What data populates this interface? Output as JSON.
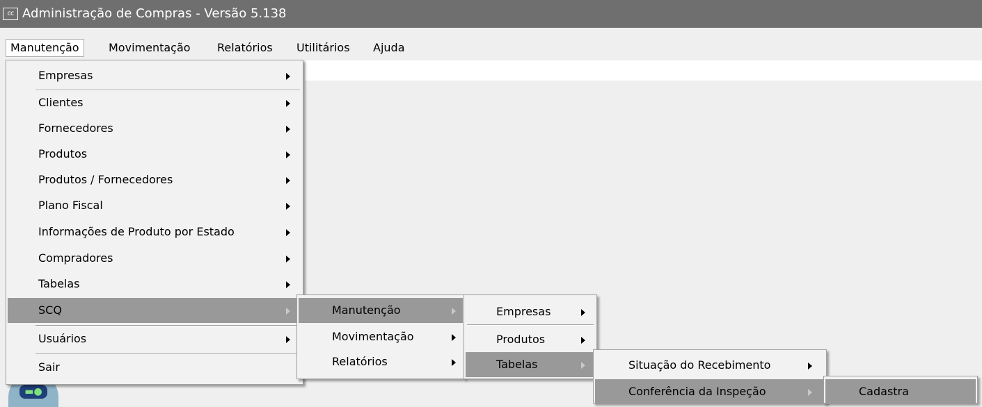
{
  "window": {
    "icon_text": "cc",
    "title": "Administração de Compras - Versão 5.138"
  },
  "menubar": {
    "items": [
      "Manutenção",
      "Movimentação",
      "Relatórios",
      "Utilitários",
      "Ajuda"
    ]
  },
  "menu_main": {
    "items": [
      "Empresas",
      "Clientes",
      "Fornecedores",
      "Produtos",
      "Produtos / Fornecedores",
      "Plano Fiscal",
      "Informações de Produto por Estado",
      "Compradores",
      "Tabelas",
      "SCQ",
      "Usuários",
      "Sair"
    ]
  },
  "menu_scq": {
    "items": [
      "Manutenção",
      "Movimentação",
      "Relatórios"
    ]
  },
  "menu_scq_manut": {
    "items": [
      "Empresas",
      "Produtos",
      "Tabelas"
    ]
  },
  "menu_tabelas": {
    "items": [
      "Situação do Recebimento",
      "Conferência da Inspeção"
    ]
  },
  "menu_conferencia": {
    "items": [
      "Cadastra"
    ]
  }
}
